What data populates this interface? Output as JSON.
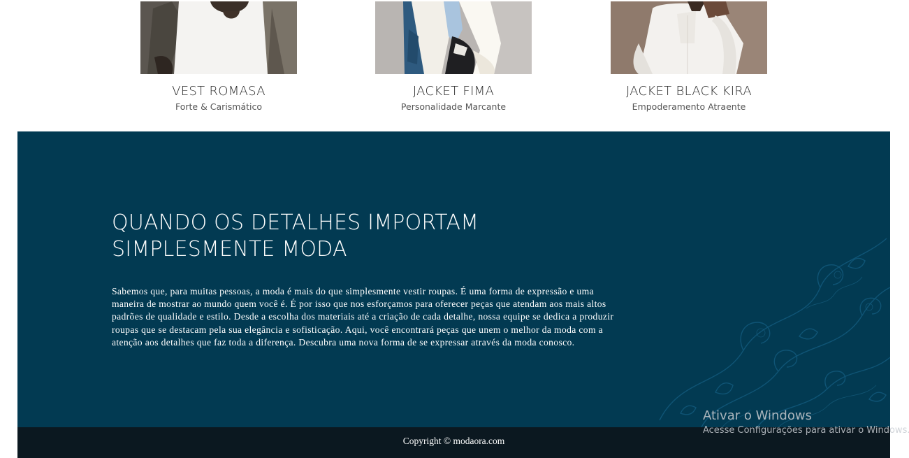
{
  "products": [
    {
      "name": "VEST ROMASA",
      "tagline": "Forte & Carismático"
    },
    {
      "name": "JACKET FIMA",
      "tagline": "Personalidade Marcante"
    },
    {
      "name": "JACKET BLACK KIRA",
      "tagline": "Empoderamento Atraente"
    }
  ],
  "feature": {
    "heading_line1": "QUANDO OS DETALHES IMPORTAM",
    "heading_line2": "SIMPLESMENTE MODA",
    "body": "Sabemos que, para muitas pessoas, a moda é mais do que simplesmente vestir roupas. É uma forma de expressão e uma maneira de mostrar ao mundo quem você é. É por isso que nos esforçamos para oferecer peças que atendam aos mais altos padrões de qualidade e estilo. Desde a escolha dos materiais até a criação de cada detalhe, nossa equipe se dedica a produzir roupas que se destacam pela sua elegância e sofisticação. Aqui, você encontrará peças que unem o melhor da moda com a atenção aos detalhes que faz toda a diferença. Descubra uma nova forma de se expressar através da moda conosco."
  },
  "footer": {
    "copyright": "Copyright © modaora.com"
  },
  "os_watermark": {
    "title": "Ativar o Windows",
    "subtitle": "Acesse Configurações para ativar o Windows."
  },
  "colors": {
    "feature_bg": "#023a52",
    "footer_bg": "#0b1820"
  }
}
